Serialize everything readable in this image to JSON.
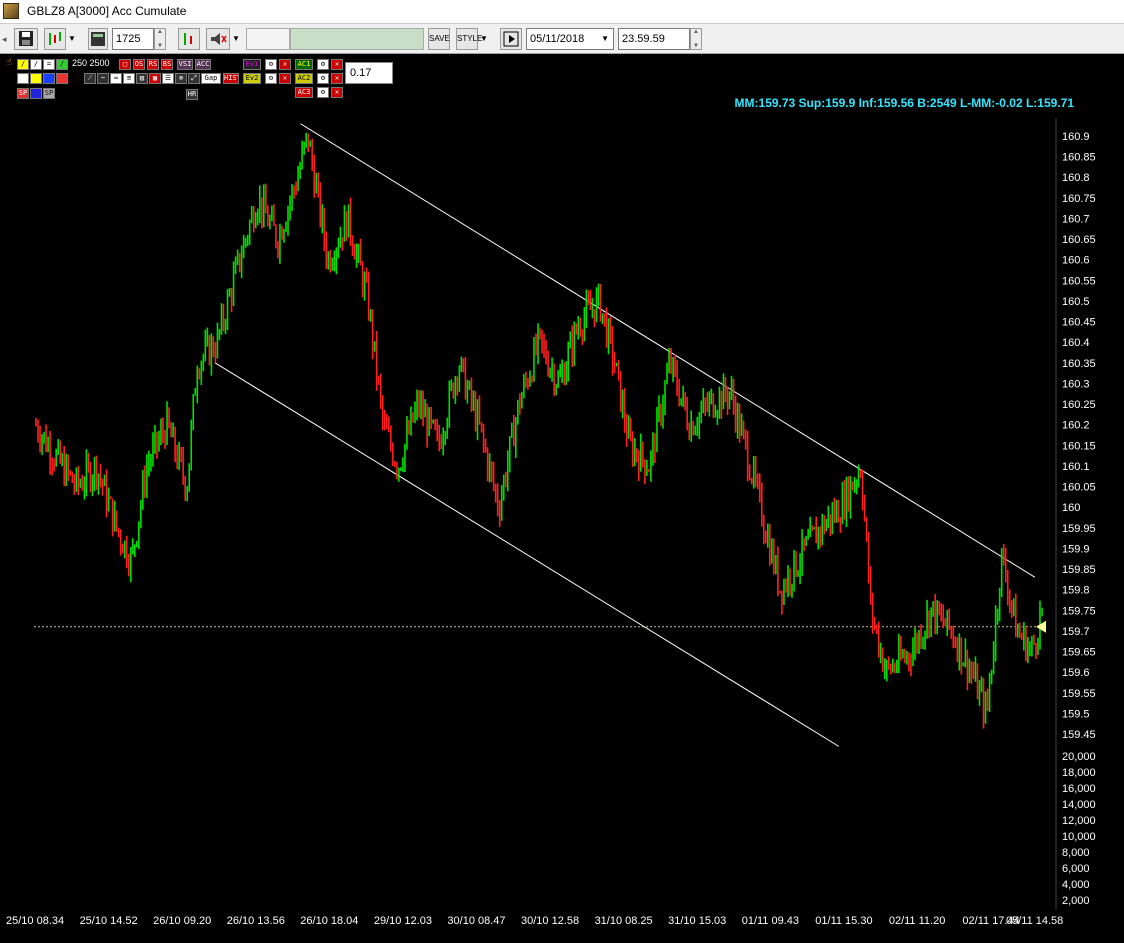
{
  "window": {
    "title": "GBLZ8 A[3000] Acc Cumulate"
  },
  "toolbar": {
    "count_value": "1725",
    "date_value": "05/11/2018",
    "time_value": "23.59.59",
    "save_label": "SAVE",
    "style_label": "STYLE"
  },
  "tools": {
    "values_label": "250 2500",
    "setting_value": "0.17",
    "labels": [
      "OS",
      "RS",
      "BS",
      "VSI",
      "ACC",
      "Ev1",
      "Ev2",
      "AC1",
      "AC2",
      "AC3",
      "Gap",
      "HIST",
      "HR",
      "SP",
      "SP"
    ]
  },
  "info_line": "MM:159.73 Sup:159.9 Inf:159.56 B:2549 L-MM:-0.02 L:159.71",
  "chart_data": {
    "type": "bar",
    "title": "",
    "up_color": "#00e000",
    "down_color": "#ff2020",
    "y_range": [
      159.42,
      160.93
    ],
    "price_ticks": [
      "160.9",
      "160.85",
      "160.8",
      "160.75",
      "160.7",
      "160.65",
      "160.6",
      "160.55",
      "160.5",
      "160.45",
      "160.4",
      "160.35",
      "160.3",
      "160.25",
      "160.2",
      "160.15",
      "160.1",
      "160.05",
      "160",
      "159.95",
      "159.9",
      "159.85",
      "159.8",
      "159.75",
      "159.7",
      "159.65",
      "159.6",
      "159.55",
      "159.5",
      "159.45"
    ],
    "volume_ticks": [
      "20,000",
      "18,000",
      "16,000",
      "14,000",
      "12,000",
      "10,000",
      "8,000",
      "6,000",
      "4,000",
      "2,000"
    ],
    "time_labels": [
      "25/10 08.34",
      "25/10 14.52",
      "26/10 09.20",
      "26/10 13.56",
      "26/10 18.04",
      "29/10 12.03",
      "30/10 08.47",
      "30/10 12.58",
      "31/10 08.25",
      "31/10 15.03",
      "01/11 09.43",
      "01/11 15.30",
      "02/11 11.20",
      "02/11 17.44",
      "05/11 14.58"
    ],
    "reference_line": 159.71,
    "price_points": [
      [
        0,
        160.2
      ],
      [
        0.02,
        160.12
      ],
      [
        0.04,
        160.05
      ],
      [
        0.06,
        160.1
      ],
      [
        0.08,
        159.95
      ],
      [
        0.095,
        159.87
      ],
      [
        0.11,
        160.1
      ],
      [
        0.13,
        160.2
      ],
      [
        0.15,
        160.05
      ],
      [
        0.16,
        160.35
      ],
      [
        0.18,
        160.4
      ],
      [
        0.2,
        160.58
      ],
      [
        0.22,
        160.75
      ],
      [
        0.24,
        160.65
      ],
      [
        0.26,
        160.8
      ],
      [
        0.27,
        160.9
      ],
      [
        0.29,
        160.6
      ],
      [
        0.31,
        160.7
      ],
      [
        0.33,
        160.5
      ],
      [
        0.345,
        160.2
      ],
      [
        0.36,
        160.1
      ],
      [
        0.38,
        160.25
      ],
      [
        0.4,
        160.15
      ],
      [
        0.42,
        160.35
      ],
      [
        0.44,
        160.2
      ],
      [
        0.46,
        160.0
      ],
      [
        0.48,
        160.25
      ],
      [
        0.5,
        160.4
      ],
      [
        0.52,
        160.3
      ],
      [
        0.54,
        160.45
      ],
      [
        0.56,
        160.5
      ],
      [
        0.575,
        160.35
      ],
      [
        0.59,
        160.15
      ],
      [
        0.61,
        160.1
      ],
      [
        0.63,
        160.35
      ],
      [
        0.65,
        160.2
      ],
      [
        0.67,
        160.25
      ],
      [
        0.69,
        160.28
      ],
      [
        0.71,
        160.1
      ],
      [
        0.725,
        159.95
      ],
      [
        0.74,
        159.8
      ],
      [
        0.76,
        159.88
      ],
      [
        0.78,
        159.95
      ],
      [
        0.8,
        160.0
      ],
      [
        0.82,
        160.1
      ],
      [
        0.83,
        159.75
      ],
      [
        0.845,
        159.6
      ],
      [
        0.87,
        159.65
      ],
      [
        0.89,
        159.75
      ],
      [
        0.91,
        159.7
      ],
      [
        0.93,
        159.6
      ],
      [
        0.945,
        159.5
      ],
      [
        0.96,
        159.88
      ],
      [
        0.975,
        159.7
      ],
      [
        0.99,
        159.65
      ],
      [
        1.0,
        159.75
      ]
    ],
    "channel_upper": [
      [
        160.92,
        0.265
      ],
      [
        159.83,
        0.995
      ]
    ],
    "channel_lower": [
      [
        160.35,
        0.18
      ],
      [
        159.42,
        0.8
      ]
    ]
  }
}
